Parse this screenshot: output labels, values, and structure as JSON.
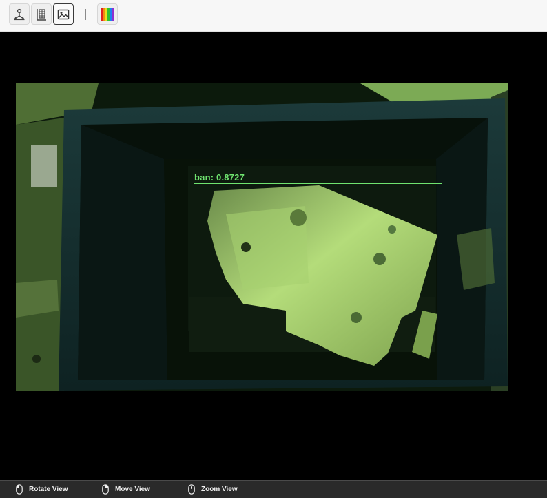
{
  "toolbar": {
    "buttons": [
      {
        "icon": "axes-3d-icon",
        "active": false
      },
      {
        "icon": "grid-list-icon",
        "active": false
      },
      {
        "icon": "image-icon",
        "active": true
      },
      {
        "icon": "color-palette-icon",
        "active": false
      }
    ]
  },
  "detection": {
    "label": "ban: 0.8727",
    "color": "#6fe36f"
  },
  "statusbar": {
    "rotate": "Rotate View",
    "move": "Move View",
    "zoom": "Zoom View"
  }
}
